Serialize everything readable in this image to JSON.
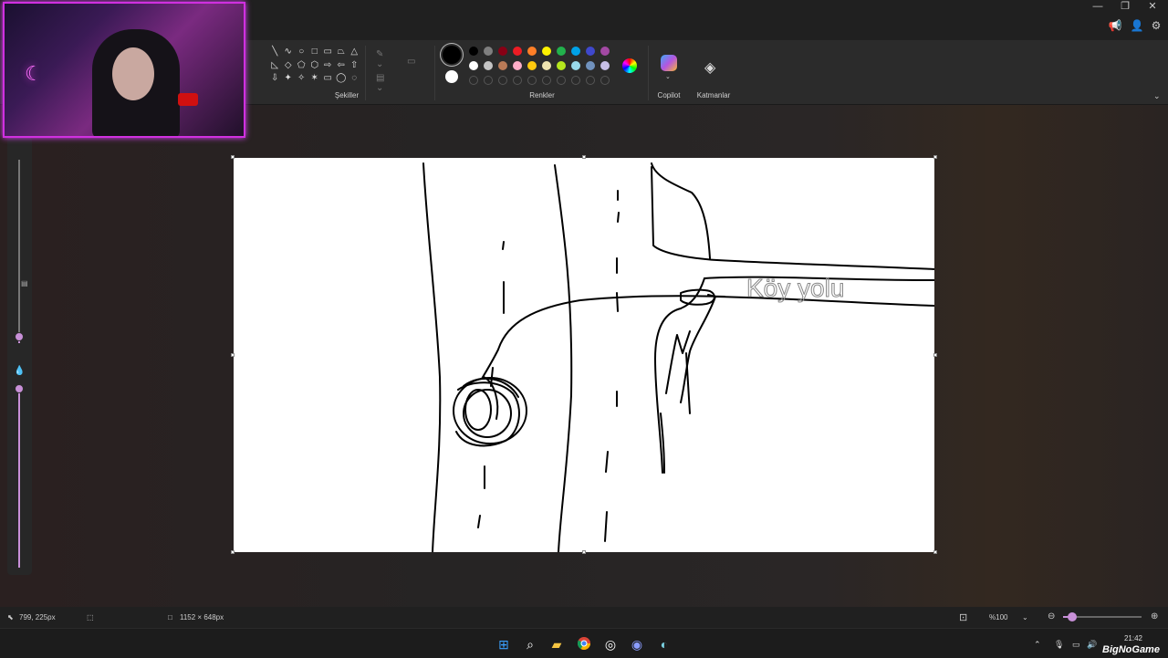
{
  "ribbon": {
    "labels": {
      "shapes": "Şekiller",
      "colors": "Renkler",
      "copilot": "Copilot",
      "layers": "Katmanlar"
    },
    "shapes": [
      "╲",
      "∿",
      "○",
      "□",
      "▭",
      "⏢",
      "△",
      "◺",
      "◇",
      "⬠",
      "⬡",
      "⇨",
      "⇦",
      "⇧",
      "⇩",
      "✦",
      "✧",
      "✶",
      "▭",
      "◯",
      "◌"
    ],
    "primary_color": "#000000",
    "secondary_color": "#ffffff",
    "palette": [
      "#000000",
      "#7f7f7f",
      "#880015",
      "#ed1c24",
      "#ff7f27",
      "#fff200",
      "#22b14c",
      "#00a2e8",
      "#3f48cc",
      "#a349a4",
      "#ffffff",
      "#c3c3c3",
      "#b97a57",
      "#ffaec9",
      "#ffc90e",
      "#efe4b0",
      "#b5e61d",
      "#99d9ea",
      "#7092be",
      "#c8bfe7"
    ]
  },
  "status": {
    "cursor_pos": "799, 225px",
    "canvas_size": "1152 × 648px",
    "zoom": "%100",
    "zoom_level_fraction": 0.12
  },
  "canvas": {
    "handwritten_text": "Köy yolu"
  },
  "taskbar": {
    "time": "21:42",
    "brand": "BigNoGame"
  }
}
